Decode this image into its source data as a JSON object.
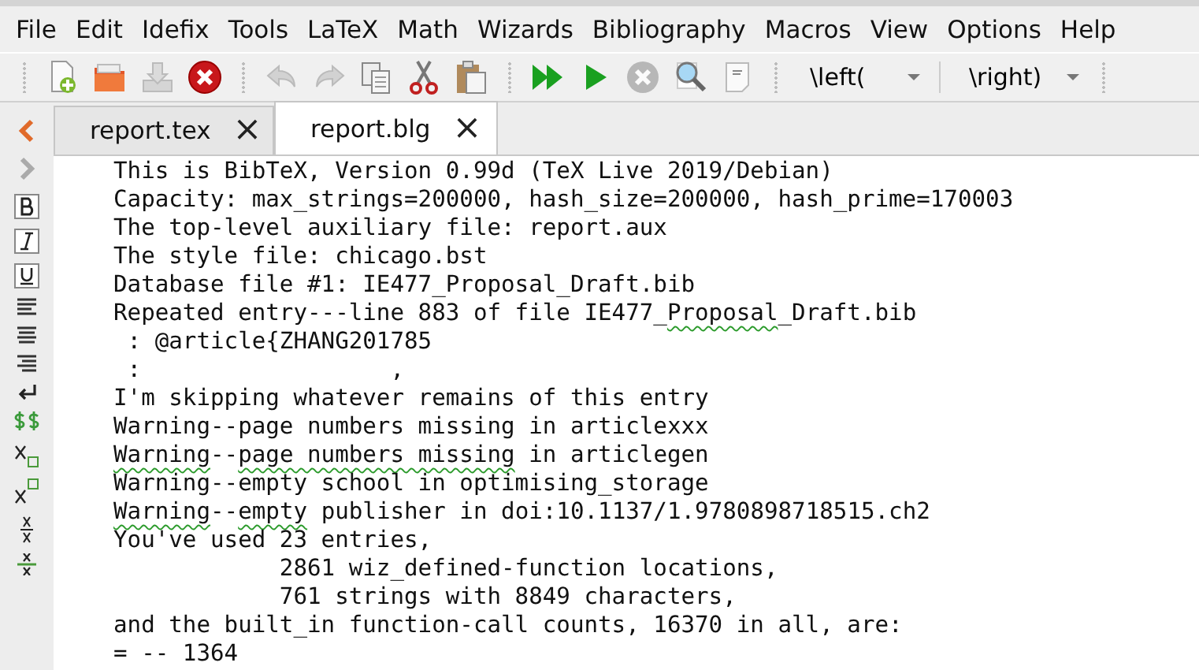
{
  "menu": [
    {
      "label": "File"
    },
    {
      "label": "Edit"
    },
    {
      "label": "Idefix"
    },
    {
      "label": "Tools"
    },
    {
      "label": "LaTeX"
    },
    {
      "label": "Math"
    },
    {
      "label": "Wizards"
    },
    {
      "label": "Bibliography"
    },
    {
      "label": "Macros"
    },
    {
      "label": "View"
    },
    {
      "label": "Options"
    },
    {
      "label": "Help"
    }
  ],
  "toolbar": [
    {
      "kind": "new",
      "disabled": false
    },
    {
      "kind": "open",
      "disabled": false
    },
    {
      "kind": "save",
      "disabled": true
    },
    {
      "kind": "close",
      "disabled": false
    },
    {
      "kind": "sep"
    },
    {
      "kind": "undo",
      "disabled": true
    },
    {
      "kind": "redo",
      "disabled": true
    },
    {
      "kind": "copy",
      "disabled": false
    },
    {
      "kind": "cut",
      "disabled": false
    },
    {
      "kind": "paste",
      "disabled": false
    },
    {
      "kind": "sep"
    },
    {
      "kind": "build",
      "disabled": false
    },
    {
      "kind": "run",
      "disabled": false
    },
    {
      "kind": "stop",
      "disabled": true
    },
    {
      "kind": "view",
      "disabled": false
    },
    {
      "kind": "log",
      "disabled": false
    },
    {
      "kind": "sep"
    }
  ],
  "dropdowns": [
    {
      "value": "\\left("
    },
    {
      "value": "\\right)"
    }
  ],
  "tabs": [
    {
      "label": "report.tex",
      "close": "×",
      "selected": false
    },
    {
      "label": "report.blg",
      "close": "×",
      "selected": true
    }
  ],
  "side_tools": [
    {
      "kind": "prev"
    },
    {
      "kind": "next"
    },
    {
      "kind": "bold"
    },
    {
      "kind": "italic"
    },
    {
      "kind": "underline"
    },
    {
      "kind": "align-left"
    },
    {
      "kind": "align-center"
    },
    {
      "kind": "align-right"
    },
    {
      "kind": "newline"
    },
    {
      "kind": "math"
    },
    {
      "kind": "sub"
    },
    {
      "kind": "sup"
    },
    {
      "kind": "frac"
    },
    {
      "kind": "dfrac"
    }
  ],
  "editor": {
    "lines": [
      [
        {
          "text": "This is BibTeX, Version 0.99d (TeX Live 2019/Debian)",
          "flagged": false
        }
      ],
      [
        {
          "text": "Capacity: max_strings=200000, hash_size=200000, hash_prime=170003",
          "flagged": false
        }
      ],
      [
        {
          "text": "The top-level auxiliary file: report.aux",
          "flagged": false
        }
      ],
      [
        {
          "text": "The style file: chicago.bst",
          "flagged": false
        }
      ],
      [
        {
          "text": "Database file #1: IE477_Proposal_Draft.bib",
          "flagged": false
        }
      ],
      [
        {
          "text": "Repeated entry---line 883 of file IE477_",
          "flagged": false
        },
        {
          "text": "Proposal",
          "flagged": true
        },
        {
          "text": "_Draft.bib",
          "flagged": false
        }
      ],
      [
        {
          "text": " : @article{ZHANG201785",
          "flagged": false
        }
      ],
      [
        {
          "text": " :                  ,",
          "flagged": false
        }
      ],
      [
        {
          "text": "I'm skipping whatever remains of this entry",
          "flagged": false
        }
      ],
      [
        {
          "text": "Warning--page numbers missing in articlexxx",
          "flagged": false
        }
      ],
      [
        {
          "text": "Warning",
          "flagged": true
        },
        {
          "text": "--",
          "flagged": false
        },
        {
          "text": "page numbers missing",
          "flagged": true
        },
        {
          "text": " in articlegen",
          "flagged": false
        }
      ],
      [
        {
          "text": "Warning--empty school in optimising_storage",
          "flagged": false
        }
      ],
      [
        {
          "text": "Warning",
          "flagged": true
        },
        {
          "text": "--",
          "flagged": false
        },
        {
          "text": "empty",
          "flagged": true
        },
        {
          "text": " publisher in doi:10.1137/1.9780898718515.ch2",
          "flagged": false
        }
      ],
      [
        {
          "text": "You've used 23 entries,",
          "flagged": false
        }
      ],
      [
        {
          "text": "            2861 wiz_defined-function locations,",
          "flagged": false
        }
      ],
      [
        {
          "text": "            761 strings with 8849 characters,",
          "flagged": false
        }
      ],
      [
        {
          "text": "and the built_in function-call counts, 16370 in all, are:",
          "flagged": false
        }
      ],
      [
        {
          "text": "= -- 1364",
          "flagged": false
        }
      ]
    ]
  }
}
